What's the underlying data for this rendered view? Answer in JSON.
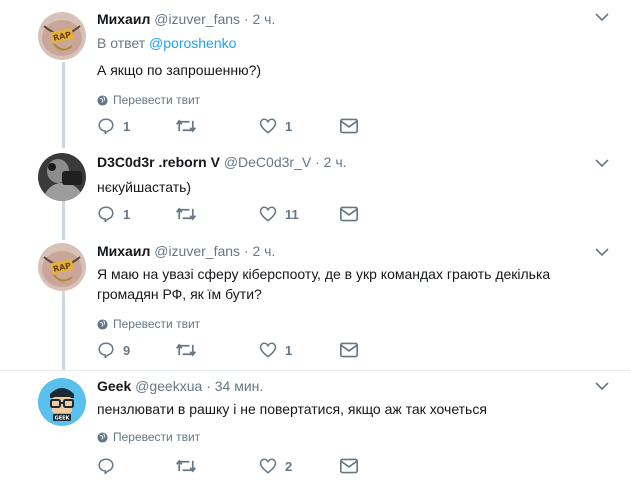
{
  "colors": {
    "link": "#1da1f2",
    "secondary": "#657786",
    "thread_line": "#ccd6dd",
    "icon": "#657786"
  },
  "tweets": [
    {
      "name": "Михаил",
      "handle": "@izuver_fans",
      "dot": "·",
      "time": "2 ч.",
      "reply_prefix": "В ответ",
      "reply_mention": "@poroshenko",
      "text": "А якщо по запрошенню?)",
      "translate": "Перевести твит",
      "replies": "1",
      "retweets": "",
      "likes": "1",
      "avatar_icon": "rap-chain-avatar"
    },
    {
      "name": "D3C0d3r .reborn V",
      "handle": "@DeC0d3r_V",
      "dot": "·",
      "time": "2 ч.",
      "text": "нєкуйшастать)",
      "replies": "1",
      "retweets": "",
      "likes": "11",
      "avatar_icon": "monochrome-photo-avatar"
    },
    {
      "name": "Михаил",
      "handle": "@izuver_fans",
      "dot": "·",
      "time": "2 ч.",
      "text": "Я маю на увазі сферу кіберспооту, де в укр командах грають декілька громадян РФ, як їм бути?",
      "translate": "Перевести твит",
      "replies": "9",
      "retweets": "",
      "likes": "1",
      "avatar_icon": "rap-chain-avatar"
    },
    {
      "name": "Geek",
      "handle": "@geekxua",
      "dot": "·",
      "time": "34 мин.",
      "text": "пензлювати в рашку і не повертатися, якщо аж так хочеться",
      "translate": "Перевести твит",
      "replies": "",
      "retweets": "",
      "likes": "2",
      "avatar_icon": "geek-glasses-avatar",
      "avatar_badge": "GEEK"
    }
  ]
}
